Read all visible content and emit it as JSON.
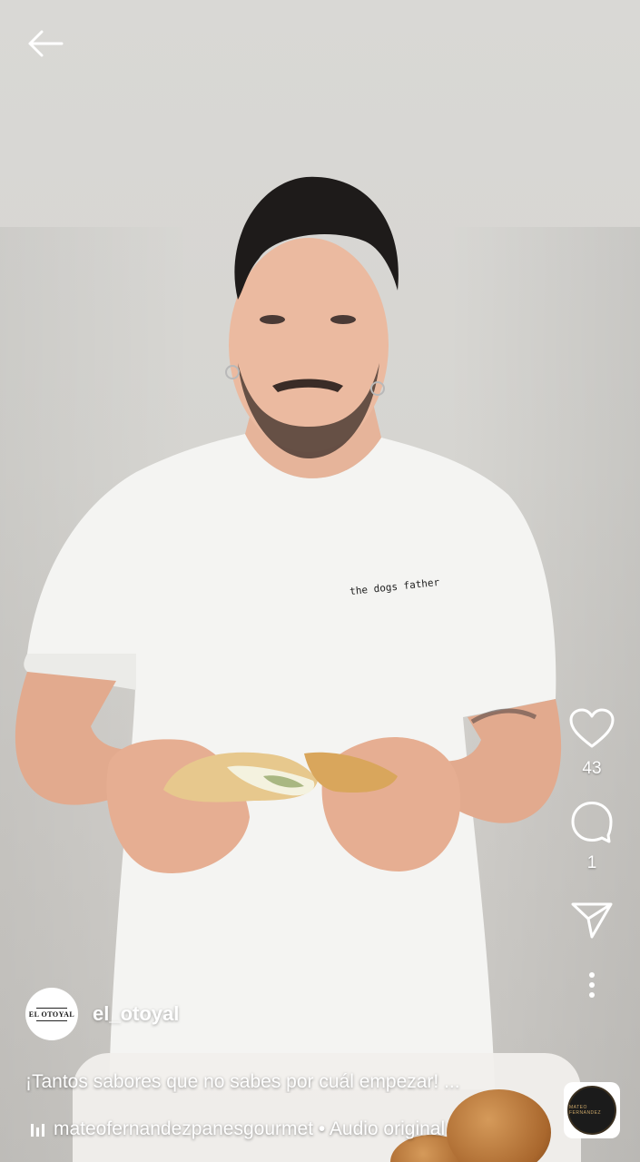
{
  "header": {
    "back_icon": "arrow-left-icon"
  },
  "actions": {
    "like": {
      "icon": "heart-icon",
      "count": "43"
    },
    "comment": {
      "icon": "comment-icon",
      "count": "1"
    },
    "share": {
      "icon": "send-icon"
    },
    "more": {
      "icon": "more-vertical-icon"
    }
  },
  "author": {
    "username": "el_otoyal",
    "avatar_text": "EL OTOYAL"
  },
  "caption": "¡Tantos sabores que no sabes por cuál empezar! ...",
  "audio": {
    "icon": "audio-bars-icon",
    "label": "mateofernandezpanesgourmet • Audio original",
    "thumb_text": "MATEO FERNANDEZ"
  },
  "video_overlay": {
    "shirt_text": "the dogs father"
  },
  "colors": {
    "overlay_text": "#ffffff",
    "background_wall": "#d9d8d5"
  }
}
